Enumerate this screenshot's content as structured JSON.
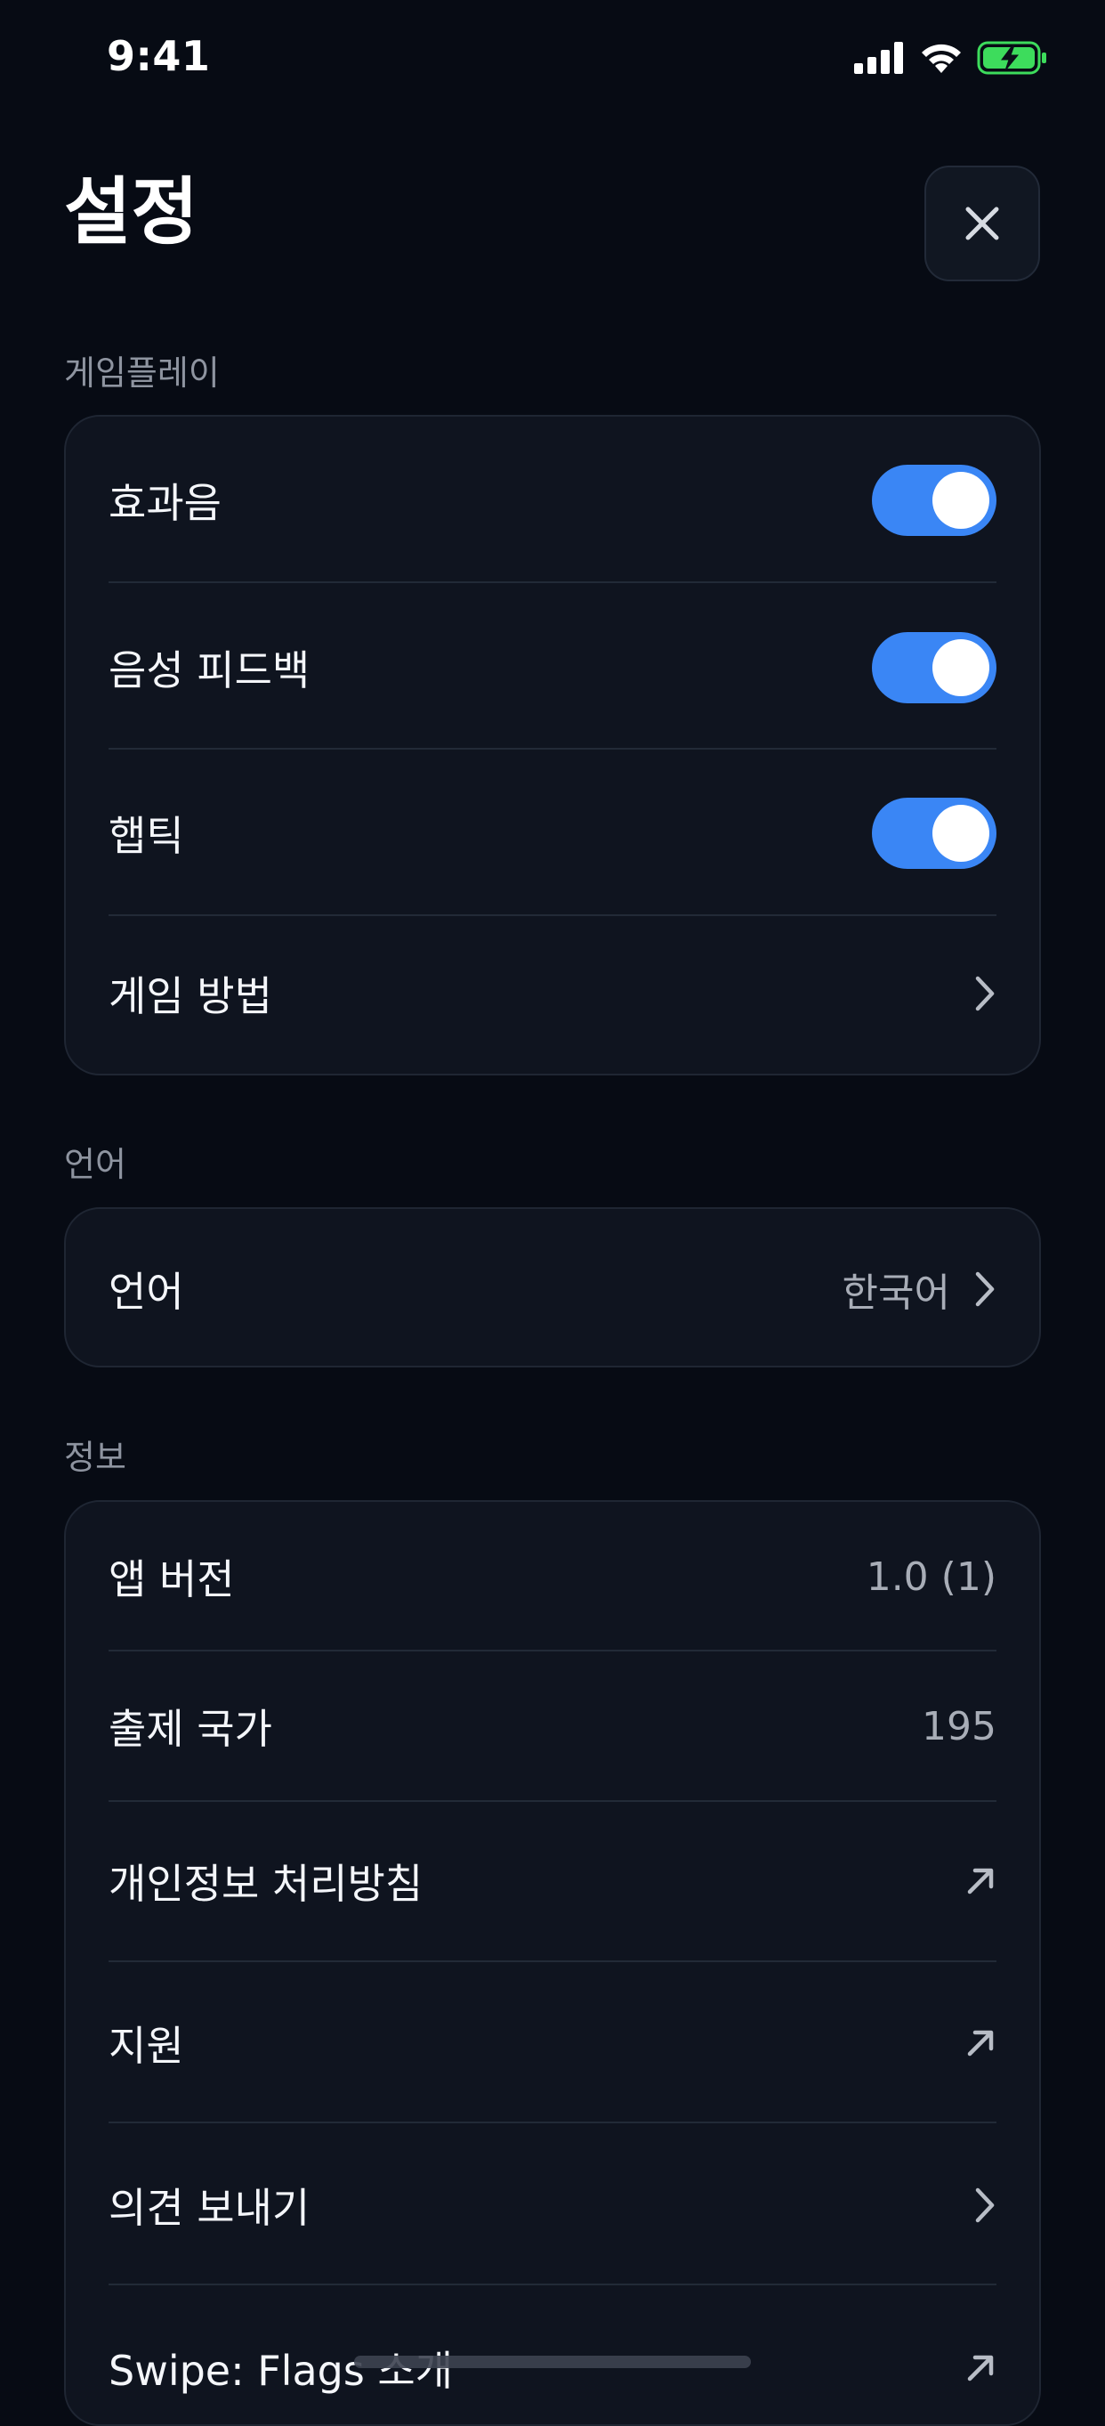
{
  "status_bar": {
    "time": "9:41",
    "battery_color": "#3ddc5c"
  },
  "header": {
    "title": "설정",
    "close_icon": "close-icon"
  },
  "sections": {
    "gameplay": {
      "label": "게임플레이",
      "rows": [
        {
          "label": "효과음",
          "control": "toggle",
          "on": true
        },
        {
          "label": "음성 피드백",
          "control": "toggle",
          "on": true
        },
        {
          "label": "햅틱",
          "control": "toggle",
          "on": true
        },
        {
          "label": "게임 방법",
          "control": "chevron-right-icon"
        }
      ]
    },
    "language": {
      "label": "언어",
      "rows": [
        {
          "label": "언어",
          "value": "한국어",
          "control": "chevron-right-icon"
        }
      ]
    },
    "info": {
      "label": "정보",
      "rows": [
        {
          "label": "앱 버전",
          "value": "1.0 (1)"
        },
        {
          "label": "출제 국가",
          "value": "195"
        },
        {
          "label": "개인정보 처리방침",
          "control": "external-link-icon"
        },
        {
          "label": "지원",
          "control": "external-link-icon"
        },
        {
          "label": "의견 보내기",
          "control": "chevron-right-icon"
        },
        {
          "label": "Swipe: Flags 소개",
          "control": "external-link-icon"
        }
      ]
    }
  },
  "colors": {
    "background": "#070b14",
    "card": "#0f141f",
    "accent": "#3a86f5"
  }
}
